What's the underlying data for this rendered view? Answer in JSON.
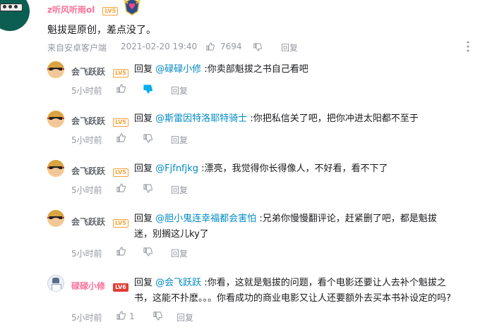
{
  "main_comment": {
    "username": "z听风听雨ol",
    "level": "LV5",
    "text": "魁拔是原创，差点没了。",
    "source": "来自安卓客户端",
    "datetime": "2021-02-20 19:40",
    "likes": "7694",
    "reply_label": "回复"
  },
  "reply_label": "回复",
  "replies": [
    {
      "username": "会飞跃跃",
      "level": "LV5",
      "prefix": "回复",
      "mention": "@碌碌小修",
      "line1": ":你卖部魁拔之书自己看吧",
      "line2": "",
      "time": "5小时前",
      "likes": "",
      "action": "回复"
    },
    {
      "username": "会飞跃跃",
      "level": "LV5",
      "prefix": "回复",
      "mention": "@斯雷因特洛耶特骑士",
      "line1": ":你把私信关了吧，把你冲进太阳都不至于",
      "line2": "",
      "time": "5小时前",
      "likes": "",
      "action": "回复"
    },
    {
      "username": "会飞跃跃",
      "level": "LV5",
      "prefix": "回复",
      "mention": "@Fjfnfjkg",
      "line1": ":漂亮，我觉得你长得像人，不好看，看不下了",
      "line2": "",
      "time": "5小时前",
      "likes": "",
      "action": "回复"
    },
    {
      "username": "会飞跃跃",
      "level": "LV5",
      "prefix": "回复",
      "mention": "@胆小鬼连幸福都会害怕",
      "line1": ":兄弟你慢慢翻评论，赶紧删了吧，都是魁拔",
      "line2": "迷，别搁这儿ky了",
      "time": "5小时前",
      "likes": "",
      "action": "回复"
    },
    {
      "username": "碌碌小修",
      "level": "LV6",
      "prefix": "回复",
      "mention": "@会飞跃跃",
      "line1": ":你看，这就是魁拔的问题，看个电影还要让人去补个魁拔之",
      "line2": "书，这能不扑麽。。。你看成功的商业电影又让人还要额外去买本书补设定的吗?",
      "time": "5小时前",
      "likes": "1",
      "action": "回复"
    }
  ],
  "colors": {
    "main_username": "#fb7299",
    "mention": "#008ac5",
    "meta": "#9499a0",
    "dislike_active": "#00aeec"
  },
  "icons": [
    "like-icon",
    "dislike-icon",
    "more-icon",
    "medal-icon"
  ]
}
